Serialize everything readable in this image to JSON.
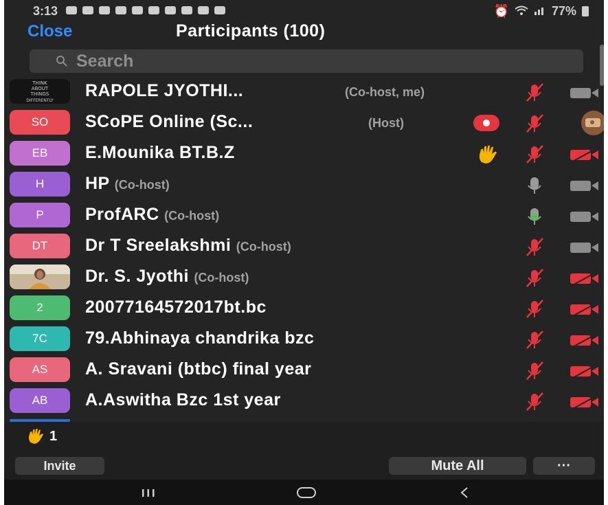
{
  "status_bar": {
    "time": "3:13",
    "battery": "77%"
  },
  "header": {
    "close_label": "Close",
    "title": "Participants (100)"
  },
  "search": {
    "placeholder": "Search"
  },
  "participants": [
    {
      "initials": "",
      "name": "RAPOLE JYOTHI...",
      "role": "(Co-host, me)",
      "avatar_type": "image",
      "avatar_text": [
        "THINK",
        "ABOUT",
        "THINGS",
        "DIFFERENTLY"
      ],
      "mic": "muted",
      "video": "on",
      "extra": "",
      "row_top": 0
    },
    {
      "initials": "SO",
      "name": "SCoPE Online (Sc...",
      "role": "(Host)",
      "avatar_color": "#e94b56",
      "mic": "muted",
      "video": "share",
      "extra": "recording"
    },
    {
      "initials": "EB",
      "name": "E.Mounika BT.B.Z",
      "role": "",
      "avatar_color": "#c270cf",
      "mic": "muted",
      "video": "off",
      "extra": "raised-hand"
    },
    {
      "initials": "H",
      "name": "HP",
      "role": "(Co-host)",
      "avatar_color": "#9b5fd4",
      "mic": "unmuted-idle",
      "video": "on",
      "extra": ""
    },
    {
      "initials": "P",
      "name": "ProfARC",
      "role": "(Co-host)",
      "avatar_color": "#b067d4",
      "mic": "unmuted-active",
      "video": "on",
      "extra": ""
    },
    {
      "initials": "DT",
      "name": "Dr T Sreelakshmi",
      "role": "(Co-host)",
      "avatar_color": "#e9677d",
      "mic": "muted",
      "video": "on",
      "extra": ""
    },
    {
      "initials": "",
      "name": "Dr. S. Jyothi",
      "role": "(Co-host)",
      "avatar_type": "photo",
      "mic": "muted",
      "video": "off",
      "extra": ""
    },
    {
      "initials": "2",
      "name": "20077164572017bt.bc",
      "role": "",
      "avatar_color": "#4dbb72",
      "mic": "muted",
      "video": "off",
      "extra": ""
    },
    {
      "initials": "7C",
      "name": "79.Abhinaya chandrika bzc",
      "role": "",
      "avatar_color": "#2fb8b0",
      "mic": "muted",
      "video": "off",
      "extra": ""
    },
    {
      "initials": "AS",
      "name": "A. Sravani (btbc) final year",
      "role": "",
      "avatar_color": "#e9677d",
      "mic": "muted",
      "video": "off",
      "extra": ""
    },
    {
      "initials": "AB",
      "name": "A.Aswitha Bzc 1st year",
      "role": "",
      "avatar_color": "#9b5fd4",
      "mic": "muted",
      "video": "off",
      "extra": ""
    }
  ],
  "footer": {
    "raised_hands_count": "1",
    "invite_label": "Invite",
    "mute_all_label": "Mute All",
    "more_label": "···"
  },
  "colors": {
    "accent": "#2d8cff",
    "muted_red": "#e5353f",
    "raised_hand": "#f5b400",
    "active_mic": "#4cc54f"
  }
}
